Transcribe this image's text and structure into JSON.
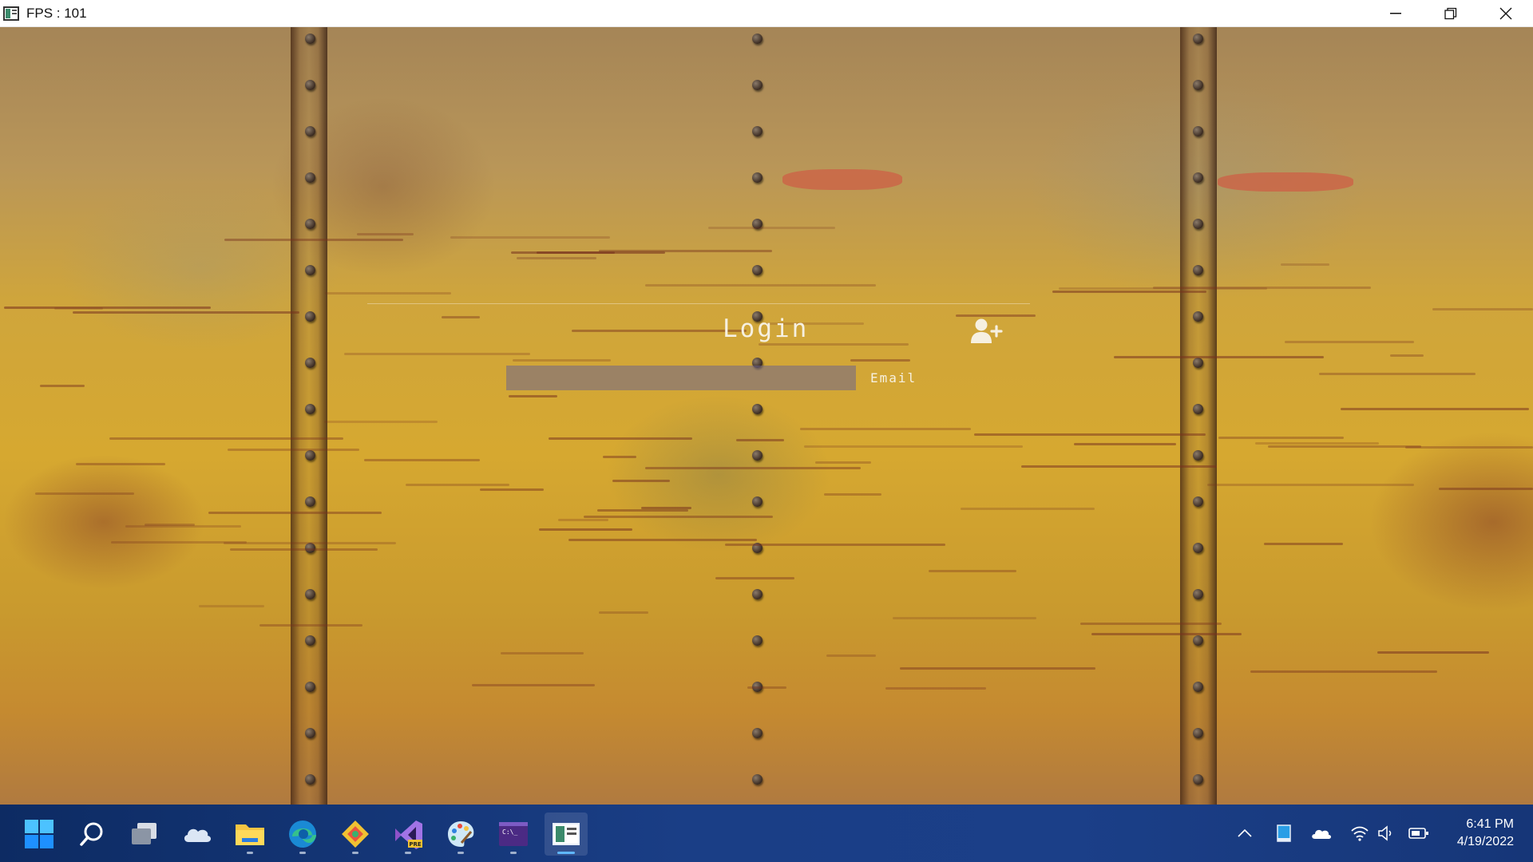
{
  "window": {
    "title": "FPS : 101",
    "icon": "app-window-icon",
    "controls": [
      "minimize-icon",
      "restore-icon",
      "close-icon"
    ]
  },
  "login": {
    "title": "Login",
    "email_label": "Email",
    "email_value": "",
    "add_user_icon": "add-user-icon"
  },
  "taskbar": {
    "apps": [
      {
        "name": "start-button",
        "icon": "windows-start-icon"
      },
      {
        "name": "search-button",
        "icon": "search-icon"
      },
      {
        "name": "task-view-button",
        "icon": "task-view-icon"
      },
      {
        "name": "onedrive-app",
        "icon": "cloud-icon"
      },
      {
        "name": "file-explorer-app",
        "icon": "folder-icon"
      },
      {
        "name": "edge-app",
        "icon": "edge-icon"
      },
      {
        "name": "git-app",
        "icon": "git-icon"
      },
      {
        "name": "visual-studio-preview-app",
        "icon": "visual-studio-icon",
        "badge": "PRE"
      },
      {
        "name": "paint-app",
        "icon": "paint-palette-icon"
      },
      {
        "name": "terminal-app",
        "icon": "terminal-icon",
        "text": "C:\\_"
      },
      {
        "name": "current-app",
        "icon": "app-window-icon",
        "active": true
      }
    ],
    "tray": [
      "chevron-up-icon",
      "tablet-icon",
      "cloud-icon",
      "wifi-icon",
      "volume-icon",
      "battery-icon"
    ],
    "time": "6:41 PM",
    "date": "4/19/2022"
  },
  "colors": {
    "taskbar": "#1a3e86",
    "accent": "#5fb7ff",
    "input_bg": "#6e648c"
  }
}
